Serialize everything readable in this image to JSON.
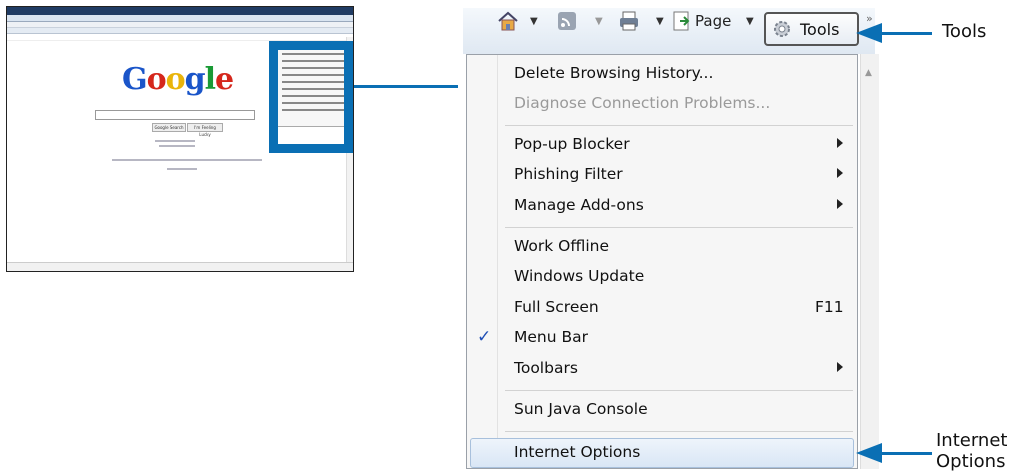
{
  "thumbnail": {
    "logo_text": "Google",
    "buttons": [
      "Google Search",
      "I'm Feeling Lucky"
    ]
  },
  "toolbar": {
    "page_label": "Page",
    "tools_label": "Tools"
  },
  "menu": {
    "items": [
      {
        "label": "Delete Browsing History...",
        "disabled": false
      },
      {
        "label": "Diagnose Connection Problems...",
        "disabled": true
      },
      {
        "label": "Pop-up Blocker",
        "submenu": true
      },
      {
        "label": "Phishing Filter",
        "submenu": true
      },
      {
        "label": "Manage Add-ons",
        "submenu": true
      },
      {
        "label": "Work Offline"
      },
      {
        "label": "Windows Update"
      },
      {
        "label": "Full Screen",
        "shortcut": "F11"
      },
      {
        "label": "Menu Bar",
        "checked": true
      },
      {
        "label": "Toolbars",
        "submenu": true
      },
      {
        "label": "Sun Java Console"
      },
      {
        "label": "Internet Options",
        "highlighted": true
      }
    ]
  },
  "callouts": {
    "tools": "Tools",
    "internet_options_line1": "Internet",
    "internet_options_line2": "Options"
  },
  "colors": {
    "callout_blue": "#0a6fb4",
    "check_blue": "#1f4fb5"
  }
}
